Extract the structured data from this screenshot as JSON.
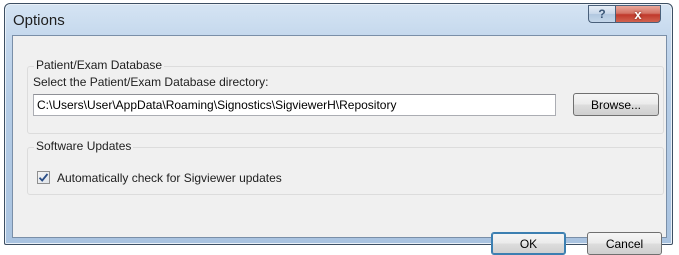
{
  "window": {
    "title": "Options"
  },
  "titlebar": {
    "help_label": "?",
    "close_label": "x"
  },
  "database_group": {
    "legend": "Patient/Exam Database",
    "prompt": "Select the Patient/Exam Database directory:",
    "path_value": "C:\\Users\\User\\AppData\\Roaming\\Signostics\\SigviewerH\\Repository",
    "browse_label": "Browse..."
  },
  "updates_group": {
    "legend": "Software Updates",
    "checkbox_label": "Automatically check for Sigviewer updates",
    "checkbox_checked": true
  },
  "footer": {
    "ok_label": "OK",
    "cancel_label": "Cancel"
  },
  "icons": {
    "help": "help-icon",
    "close": "close-icon",
    "check": "checkmark-icon"
  },
  "colors": {
    "title_bar": "#b4cce6",
    "close_button": "#c0392b",
    "client": "#f0f0f0"
  }
}
